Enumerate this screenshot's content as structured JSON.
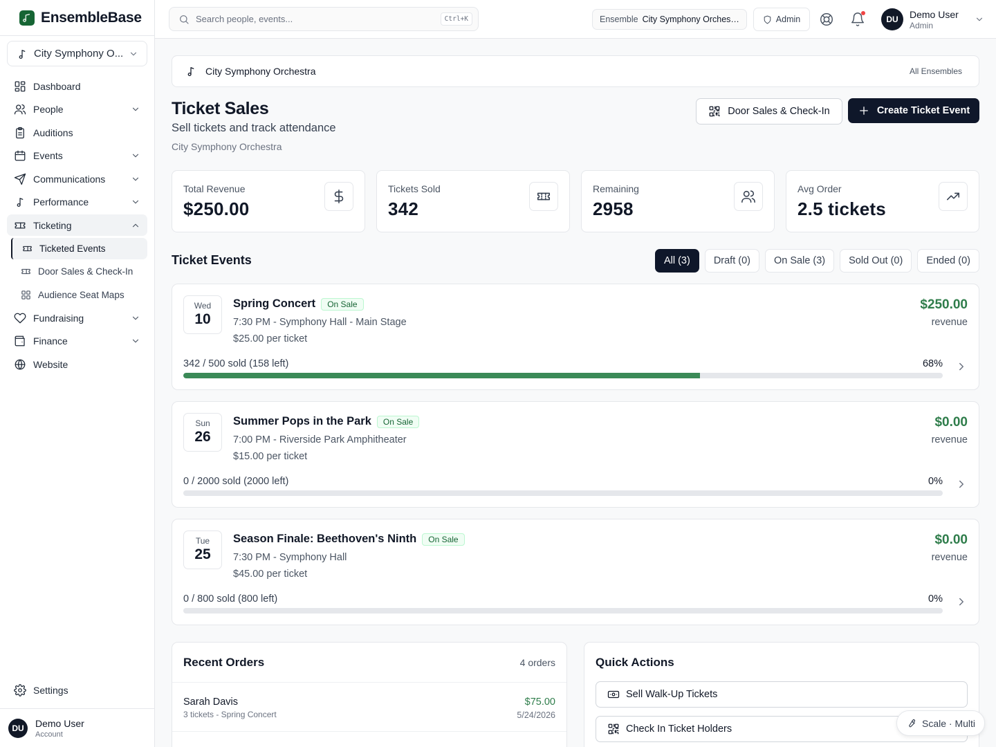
{
  "app": {
    "name": "EnsembleBase"
  },
  "sidebar": {
    "ensemble_select": "City Symphony O...",
    "items": [
      {
        "label": "Dashboard"
      },
      {
        "label": "People"
      },
      {
        "label": "Auditions"
      },
      {
        "label": "Events"
      },
      {
        "label": "Communications"
      },
      {
        "label": "Performance"
      },
      {
        "label": "Ticketing"
      },
      {
        "label": "Fundraising"
      },
      {
        "label": "Finance"
      },
      {
        "label": "Website"
      }
    ],
    "ticketing_sub": [
      {
        "label": "Ticketed Events"
      },
      {
        "label": "Door Sales & Check-In"
      },
      {
        "label": "Audience Seat Maps"
      }
    ],
    "settings": "Settings",
    "user": {
      "initials": "DU",
      "name": "Demo User",
      "role": "Account"
    }
  },
  "header": {
    "search_placeholder": "Search people, events...",
    "shortcut": "Ctrl+K",
    "ensemble_label": "Ensemble",
    "ensemble_value": "City Symphony Orchestra",
    "admin": "Admin",
    "user": {
      "initials": "DU",
      "name": "Demo User",
      "role": "Admin"
    }
  },
  "breadcrumb": {
    "title": "City Symphony Orchestra",
    "all": "All Ensembles"
  },
  "page": {
    "title": "Ticket Sales",
    "subtitle": "Sell tickets and track attendance",
    "ensemble": "City Symphony Orchestra",
    "btn_door": "Door Sales & Check-In",
    "btn_create": "Create Ticket Event"
  },
  "stats": [
    {
      "label": "Total Revenue",
      "value": "$250.00",
      "icon": "dollar-icon"
    },
    {
      "label": "Tickets Sold",
      "value": "342",
      "icon": "ticket-icon"
    },
    {
      "label": "Remaining",
      "value": "2958",
      "icon": "users-icon"
    },
    {
      "label": "Avg Order",
      "value": "2.5 tickets",
      "icon": "trending-up-icon"
    }
  ],
  "events_section": {
    "title": "Ticket Events",
    "filters": [
      "All (3)",
      "Draft (0)",
      "On Sale (3)",
      "Sold Out (0)",
      "Ended (0)"
    ]
  },
  "events": [
    {
      "weekday": "Wed",
      "day": "10",
      "name": "Spring Concert",
      "status": "On Sale",
      "meta": "7:30 PM - Symphony Hall - Main Stage",
      "price": "$25.00 per ticket",
      "revenue": "$250.00",
      "revenue_label": "revenue",
      "sold_text": "342 / 500 sold (158 left)",
      "pct_text": "68%",
      "progress": 0.68
    },
    {
      "weekday": "Sun",
      "day": "26",
      "name": "Summer Pops in the Park",
      "status": "On Sale",
      "meta": "7:00 PM - Riverside Park Amphitheater",
      "price": "$15.00 per ticket",
      "revenue": "$0.00",
      "revenue_label": "revenue",
      "sold_text": "0 / 2000 sold (2000 left)",
      "pct_text": "0%",
      "progress": 0
    },
    {
      "weekday": "Tue",
      "day": "25",
      "name": "Season Finale: Beethoven's Ninth",
      "status": "On Sale",
      "meta": "7:30 PM - Symphony Hall",
      "price": "$45.00 per ticket",
      "revenue": "$0.00",
      "revenue_label": "revenue",
      "sold_text": "0 / 800 sold (800 left)",
      "pct_text": "0%",
      "progress": 0
    }
  ],
  "recent_orders": {
    "title": "Recent Orders",
    "count": "4 orders",
    "items": [
      {
        "name": "Sarah Davis",
        "detail": "3 tickets - Spring Concert",
        "amount": "$75.00",
        "date": "5/24/2026"
      }
    ]
  },
  "quick_actions": {
    "title": "Quick Actions",
    "items": [
      {
        "label": "Sell Walk-Up Tickets"
      },
      {
        "label": "Check In Ticket Holders"
      }
    ]
  },
  "scale_badge": "Scale · Multi",
  "colors": {
    "brand": "#166534",
    "accent_dark": "#0f172a",
    "success": "#2f7d4b",
    "progress": "#3b8a57"
  }
}
